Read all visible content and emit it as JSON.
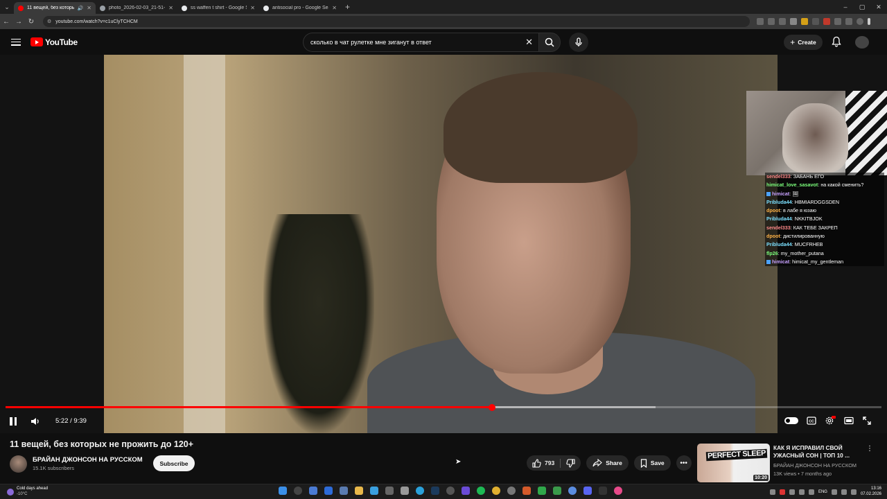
{
  "browser": {
    "tabs": [
      {
        "title": "11 вещей, без которых не",
        "active": true,
        "favicon_color": "#ff0000"
      },
      {
        "title": "photo_2026-02-03_21-51-50.jp",
        "active": false,
        "favicon_color": "#9aa0a6"
      },
      {
        "title": "ss waffen t shirt - Google Search",
        "active": false,
        "favicon_color": "#e8eaed"
      },
      {
        "title": "antisocial pro - Google Search",
        "active": false,
        "favicon_color": "#e8eaed"
      }
    ],
    "url": "youtube.com/watch?v=c1uClyTCHCM"
  },
  "header": {
    "logo_text": "YouTube",
    "search_value": "сколько в чат рулетке мне зиганут в ответ",
    "create_label": "Create"
  },
  "chat": [
    {
      "user": "sendel333",
      "color": "#ff8a8a",
      "text": "ЗАБАНЬ ЕГО",
      "icon": false
    },
    {
      "user": "himicat_love_sasavot",
      "color": "#7cff7c",
      "text": "на какой сменить?",
      "icon": false
    },
    {
      "user": "himicat",
      "color": "#c8a2ff",
      "text": "🖼",
      "icon": true
    },
    {
      "user": "Pribluda44",
      "color": "#7ce0ff",
      "text": "HBMIARDGGSDEN",
      "icon": false
    },
    {
      "user": "dpoot",
      "color": "#ffb347",
      "text": "в лабе я юзаю",
      "icon": false
    },
    {
      "user": "Pribluda44",
      "color": "#7ce0ff",
      "text": "NKKITBJOK",
      "icon": false
    },
    {
      "user": "sendel333",
      "color": "#ff8a8a",
      "text": "КАК ТЕБЕ ЗАКРЕП",
      "icon": false
    },
    {
      "user": "dpoot",
      "color": "#ffb347",
      "text": "дистилированную",
      "icon": false
    },
    {
      "user": "Pribluda44",
      "color": "#7ce0ff",
      "text": "MUCFRHEB",
      "icon": false
    },
    {
      "user": "flp26",
      "color": "#7cff7c",
      "text": "my_mother_putana",
      "icon": false
    },
    {
      "user": "himicat",
      "color": "#c8a2ff",
      "text": "himicat_my_gentleman",
      "icon": true
    }
  ],
  "player": {
    "time": "5:22 / 9:39",
    "progress_fraction": 0.555,
    "buffered_fraction": 0.742
  },
  "video": {
    "title": "11 вещей, без которых не прожить до 120+",
    "channel": "БРАЙАН ДЖОНСОН НА РУССКОМ",
    "subscribers": "15.1K subscribers",
    "subscribe_label": "Subscribe",
    "likes": "793",
    "share_label": "Share",
    "save_label": "Save"
  },
  "recommendation": {
    "title": "КАК Я ИСПРАВИЛ СВОЙ УЖАСНЫЙ СОН | ТОП 10 ...",
    "channel": "БРАЙАН ДЖОНСОН НА РУССКОМ",
    "meta": "13K views • 7 months ago",
    "duration": "10:20",
    "thumb_text": "PERFECT SLEEP"
  },
  "taskbar": {
    "weather_title": "Cold days ahead",
    "weather_temp": "-10°C",
    "lang": "ENG",
    "time": "13:16",
    "date": "07.02.2026"
  }
}
